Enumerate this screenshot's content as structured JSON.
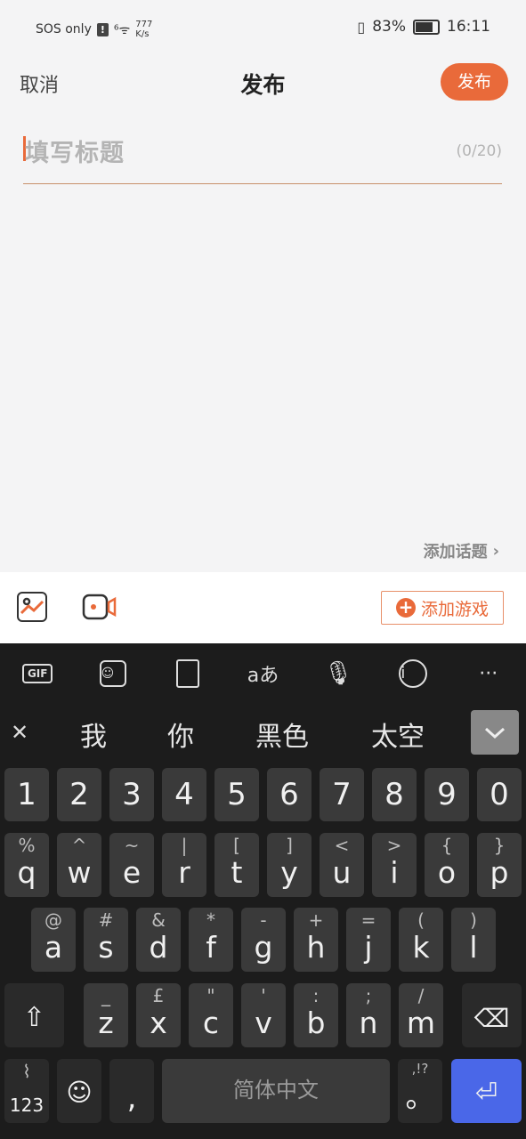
{
  "status": {
    "carrier": "SOS only",
    "speed_top": "777",
    "speed_bottom": "K/s",
    "battery": "83%",
    "time": "16:11"
  },
  "header": {
    "cancel": "取消",
    "title": "发布",
    "publish": "发布"
  },
  "editor": {
    "placeholder": "填写标题",
    "count": "(0/20)",
    "topic": "添加话题"
  },
  "toolbar": {
    "add_game": "添加游戏"
  },
  "keyboard": {
    "tools": [
      "GIF",
      "sticker",
      "clipboard",
      "aあ",
      "mic",
      "info",
      "···"
    ],
    "candidates": [
      "我",
      "你",
      "黑色",
      "太空"
    ],
    "numbers": [
      "1",
      "2",
      "3",
      "4",
      "5",
      "6",
      "7",
      "8",
      "9",
      "0"
    ],
    "row1": [
      [
        "%",
        "q"
      ],
      [
        "^",
        "w"
      ],
      [
        "~",
        "e"
      ],
      [
        "|",
        "r"
      ],
      [
        "[",
        "t"
      ],
      [
        "]",
        "y"
      ],
      [
        "<",
        "u"
      ],
      [
        ">",
        "i"
      ],
      [
        "{",
        "o"
      ],
      [
        "}",
        "p"
      ]
    ],
    "row2": [
      [
        "@",
        "a"
      ],
      [
        "#",
        "s"
      ],
      [
        "&",
        "d"
      ],
      [
        "*",
        "f"
      ],
      [
        "-",
        "g"
      ],
      [
        "+",
        "h"
      ],
      [
        "=",
        "j"
      ],
      [
        "(",
        "k"
      ],
      [
        ")",
        "l"
      ]
    ],
    "row3": [
      [
        "_",
        "z"
      ],
      [
        "£",
        "x"
      ],
      [
        "\"",
        "c"
      ],
      [
        "'",
        "v"
      ],
      [
        ":",
        "b"
      ],
      [
        ";",
        "n"
      ],
      [
        "/",
        "m"
      ]
    ],
    "sym_label": "123",
    "comma": ",",
    "space": "简体中文",
    "punct_top": ",!?",
    "punct_bottom": "。"
  }
}
